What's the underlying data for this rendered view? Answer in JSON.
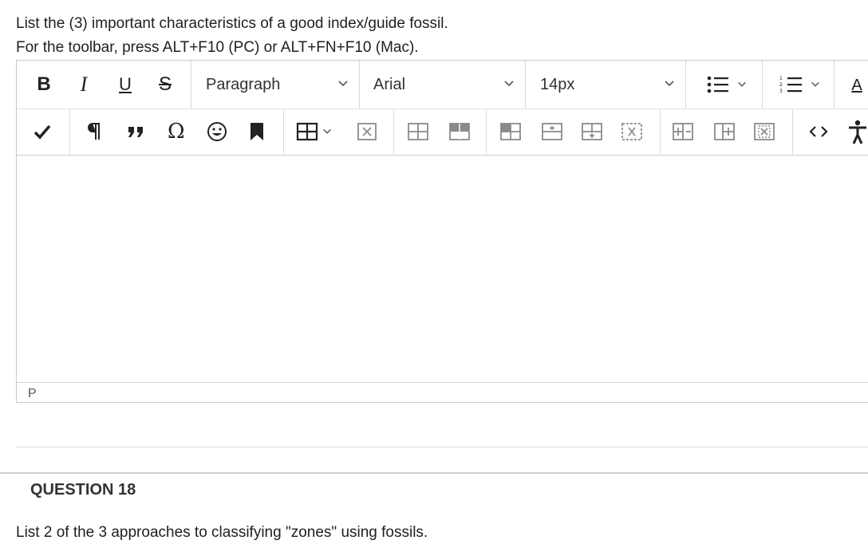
{
  "question_intro": {
    "line1": "List the (3) important characteristics of a good index/guide fossil.",
    "line2": "For the toolbar, press ALT+F10 (PC) or ALT+FN+F10 (Mac)."
  },
  "editor": {
    "toolbar_row1": {
      "bold_label": "B",
      "italic_label": "I",
      "underline_label": "U",
      "strike_label": "S",
      "block_format": "Paragraph",
      "font_family": "Arial",
      "font_size": "14px",
      "text_color_label": "A"
    },
    "toolbar_row2_icons": [
      "spellcheck-icon",
      "paragraph-mark-icon",
      "blockquote-icon",
      "omega-special-char-icon",
      "emoji-icon",
      "bookmark-icon",
      "table-icon",
      "delete-table-icon",
      "table-split-icon",
      "table-header-icon",
      "table-cell-icon",
      "insert-row-above-icon",
      "insert-row-below-icon",
      "delete-row-icon",
      "insert-col-left-icon",
      "insert-col-right-icon",
      "delete-col-icon",
      "code-view-icon",
      "accessibility-icon"
    ],
    "status_path": "P"
  },
  "question": {
    "heading": "QUESTION 18",
    "text": "List 2 of the 3 approaches to classifying \"zones\" using fossils."
  },
  "colors": {
    "icon": "#222222",
    "icon_light": "#8a8a8a",
    "border": "#c9c9c9"
  }
}
